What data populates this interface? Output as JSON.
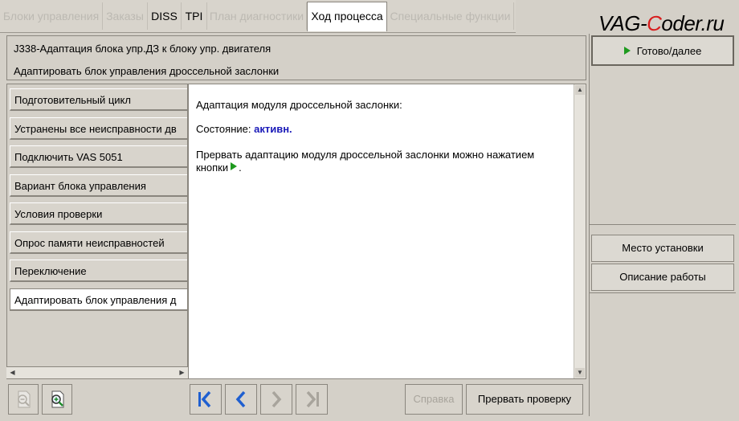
{
  "tabs": [
    {
      "label": "Блоки управления",
      "state": "disabled"
    },
    {
      "label": "Заказы",
      "state": "disabled"
    },
    {
      "label": "DISS",
      "state": "enabled"
    },
    {
      "label": "TPI",
      "state": "enabled"
    },
    {
      "label": "План диагностики",
      "state": "disabled"
    },
    {
      "label": "Ход процесса",
      "state": "active"
    },
    {
      "label": "Специальные функции",
      "state": "disabled"
    }
  ],
  "brand": {
    "prefix": "VAG-",
    "accent": "C",
    "suffix": "oder.ru"
  },
  "header": {
    "line1": "J338-Адаптация блока упр.ДЗ к блоку упр. двигателя",
    "line2": "Адаптировать блок управления дроссельной заслонки"
  },
  "steps": [
    {
      "label": "Подготовительный цикл"
    },
    {
      "label": "Устранены все неисправности дв"
    },
    {
      "label": "Подключить VAS 5051"
    },
    {
      "label": "Вариант блока управления"
    },
    {
      "label": "Условия проверки"
    },
    {
      "label": "Опрос памяти неисправностей"
    },
    {
      "label": "Переключение"
    },
    {
      "label": "Адаптировать блок управления д"
    }
  ],
  "content": {
    "line1": "Адаптация модуля дроссельной заслонки:",
    "status_label": "Состояние:",
    "status_value": "активн.",
    "note_part1": "Прервать адаптацию модуля дроссельной заслонки можно нажатием",
    "note_part2": "кнопки",
    "note_end": "."
  },
  "toolbar": {
    "help_label": "Справка",
    "abort_label": "Прервать проверку"
  },
  "right_panel": {
    "next_label": "Готово/далее",
    "location_label": "Место установки",
    "work_description_label": "Описание работы"
  },
  "colors": {
    "background": "#d4d0c8",
    "status_value": "#1a1ab8",
    "nav_arrow": "#1f5fd0",
    "play_green": "#1e9a1e",
    "brand_accent": "#d81e1e"
  },
  "icons": {
    "zoom_out": "zoom-out-icon",
    "zoom_in": "zoom-in-icon",
    "first": "first-page-icon",
    "prev": "previous-icon",
    "next": "next-icon",
    "last": "last-page-icon",
    "play": "play-icon"
  }
}
